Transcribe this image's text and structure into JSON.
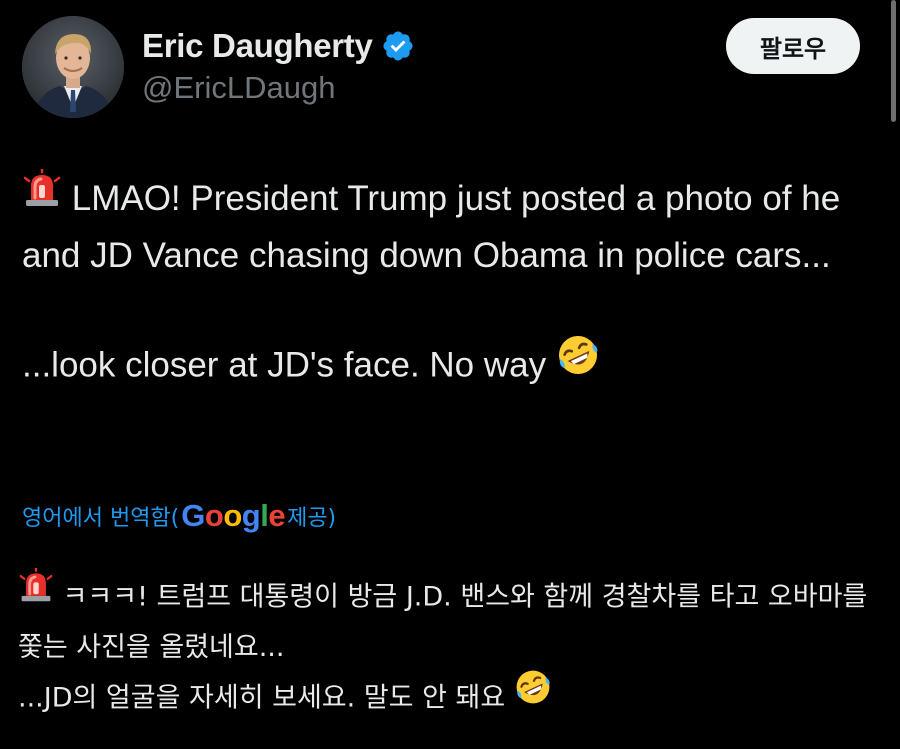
{
  "user": {
    "display_name": "Eric Daugherty",
    "handle": "@EricLDaugh",
    "verified": true
  },
  "follow_button": {
    "label": "팔로우"
  },
  "tweet": {
    "line1": "LMAO! President Trump just posted a photo of he and JD Vance chasing down Obama in police cars...",
    "line2": "...look closer at JD's face. No way",
    "emoji_start": "police-siren",
    "emoji_end": "rolling-on-floor-laughing"
  },
  "translate": {
    "prefix": "영어에서 번역함(",
    "google_letters": [
      "G",
      "o",
      "o",
      "g",
      "l",
      "e"
    ],
    "suffix": " 제공)"
  },
  "translation": {
    "line1": "ㅋㅋㅋ! 트럼프 대통령이 방금 J.D. 밴스와 함께 경찰차를 타고 오바마를 쫓는 사진을 올렸네요...",
    "line2": "...JD의 얼굴을 자세히 보세요. 말도 안 돼요"
  },
  "colors": {
    "background": "#000000",
    "text": "#e7e9ea",
    "secondary": "#71767b",
    "link": "#1d9bf0",
    "verified": "#1d9bf0"
  }
}
